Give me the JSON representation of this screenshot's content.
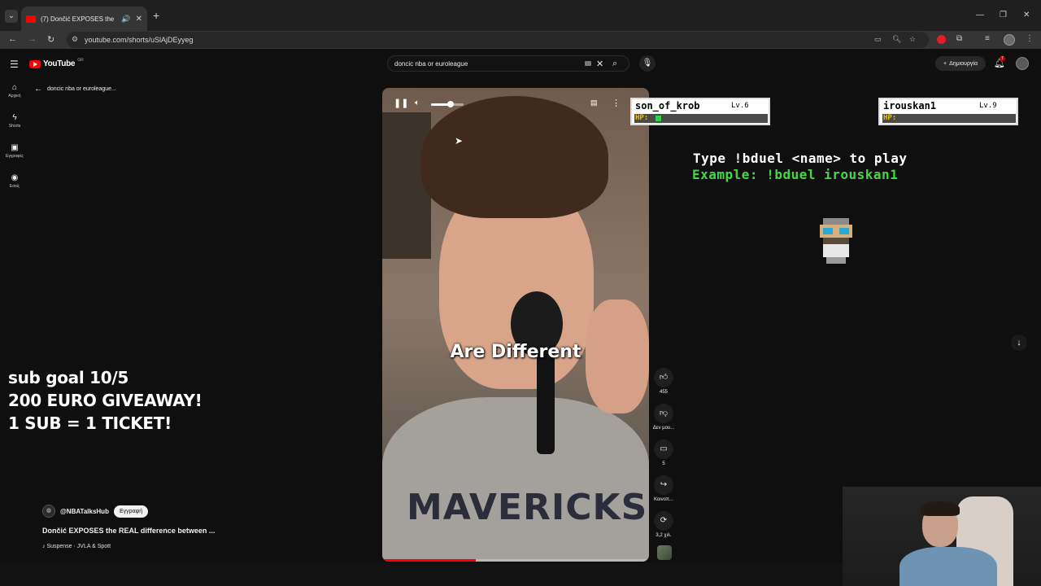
{
  "browser": {
    "tab_title": "(7) Dončić EXPOSES the REAL",
    "url": "youtube.com/shorts/uSlAjDEyyeg",
    "icons": {
      "tab_list": "chevron-down-icon",
      "audio": "speaker-icon",
      "close": "close-icon",
      "new_tab": "plus-icon"
    }
  },
  "youtube": {
    "logo_text": "YouTube",
    "region": "GR",
    "search_query": "doncic nba or euroleague",
    "create_label": "Δημιουργία",
    "notification_count": "7",
    "nav": [
      {
        "label": "Αρχική",
        "icon": "home-icon"
      },
      {
        "label": "Shorts",
        "icon": "shorts-icon"
      },
      {
        "label": "Εγγραφές",
        "icon": "subscriptions-icon"
      },
      {
        "label": "Εσείς",
        "icon": "you-icon"
      }
    ],
    "back_label": "doncic nba or euroleague..."
  },
  "overlay": {
    "sub_goal": [
      "sub goal 10/5",
      "200 EURO GIVEAWAY!",
      "1 SUB = 1 TICKET!"
    ],
    "player1": {
      "name": "son_of_krob",
      "level": "Lv.6",
      "hp_label": "HP:",
      "hp": 0.05
    },
    "player2": {
      "name": "irouskan1",
      "level": "Lv.9",
      "hp_label": "HP:",
      "hp": 0.0
    },
    "type_line": "Type !bduel <name> to play",
    "example_line": "Example: !bduel irouskan1"
  },
  "short": {
    "caption": "Are Different",
    "shirt_text": "MAVERICKS",
    "volume": 0.6,
    "progress": 0.35,
    "channel": "@NBATalksHub",
    "subscribe_label": "Εγγραφή",
    "title": "Dončić EXPOSES the REAL difference between ...",
    "music": "♪ Suspense · JVLA & Spott",
    "actions": [
      {
        "icon": "like-icon",
        "label": "455"
      },
      {
        "icon": "dislike-icon",
        "label": "Δεν μου..."
      },
      {
        "icon": "comment-icon",
        "label": "5"
      },
      {
        "icon": "share-icon",
        "label": "Κοινοπ..."
      },
      {
        "icon": "remix-icon",
        "label": "3,2 χιλ."
      }
    ]
  },
  "colors": {
    "youtube_red": "#ff0000",
    "hp_green": "#35d04a",
    "example_green": "#48d648",
    "background": "#0f0f0f"
  }
}
